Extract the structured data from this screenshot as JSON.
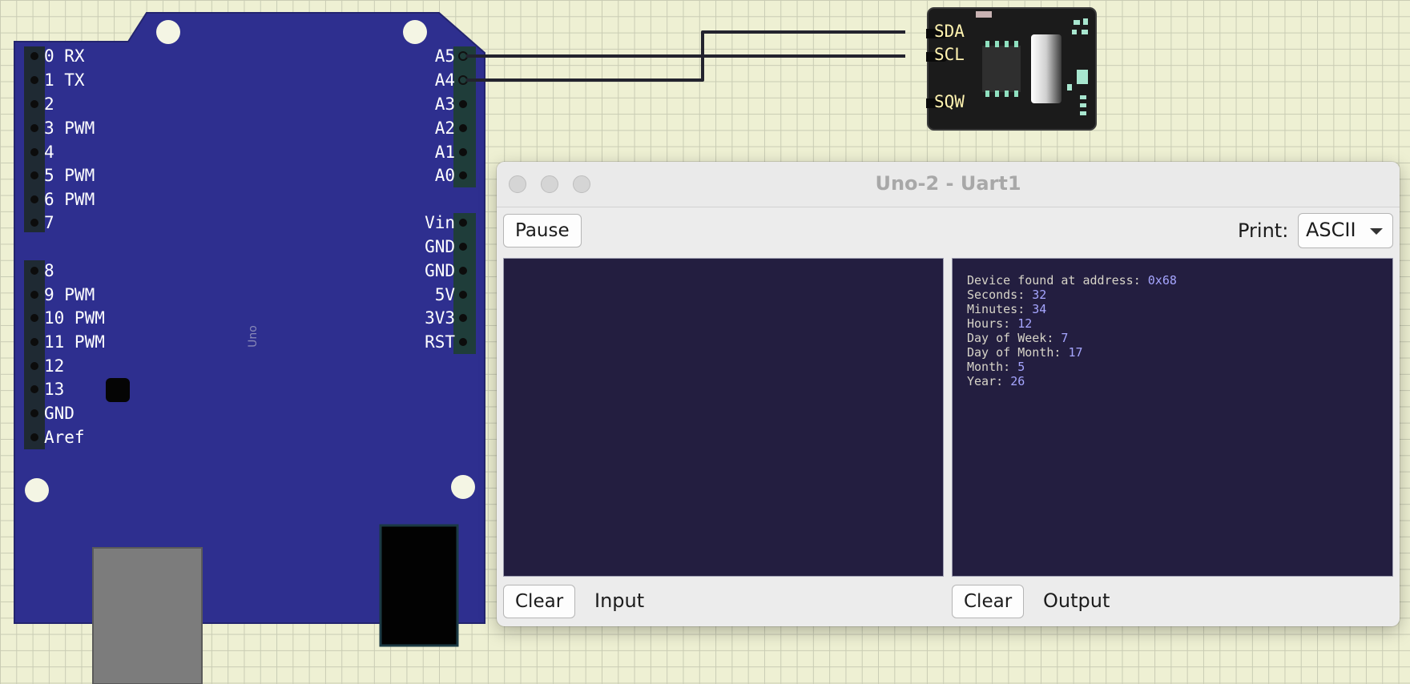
{
  "board": {
    "name_label": "Uno",
    "left_pins": [
      "0 RX",
      "1 TX",
      "2",
      "3 PWM",
      "4",
      "5 PWM",
      "6 PWM",
      "7",
      "8",
      "9 PWM",
      "10 PWM",
      "11 PWM",
      "12",
      "13",
      "GND",
      "Aref"
    ],
    "right_pins_top": [
      "A5",
      "A4",
      "A3",
      "A2",
      "A1",
      "A0"
    ],
    "right_pins_power": [
      "Vin",
      "GND",
      "GND",
      "5V",
      "3V3",
      "RST"
    ]
  },
  "rtc": {
    "pins": [
      "SDA",
      "SCL",
      "SQW"
    ]
  },
  "serial": {
    "title": "Uno-2 - Uart1",
    "pause_label": "Pause",
    "print_label": "Print:",
    "print_value": "ASCII",
    "input_clear_label": "Clear",
    "input_caption": "Input",
    "output_clear_label": "Clear",
    "output_caption": "Output",
    "output_lines": [
      {
        "key": "Device found at address: ",
        "value": "0x68"
      },
      {
        "key": "Seconds: ",
        "value": "32"
      },
      {
        "key": "Minutes: ",
        "value": "34"
      },
      {
        "key": "Hours: ",
        "value": "12"
      },
      {
        "key": "Day of Week: ",
        "value": "7"
      },
      {
        "key": "Day of Month: ",
        "value": "17"
      },
      {
        "key": "Month: ",
        "value": "5"
      },
      {
        "key": "Year: ",
        "value": "26"
      }
    ]
  },
  "colors": {
    "board": "#2e2f8f",
    "terminal_bg": "#231e40",
    "output_value": "#a6a6ff"
  }
}
